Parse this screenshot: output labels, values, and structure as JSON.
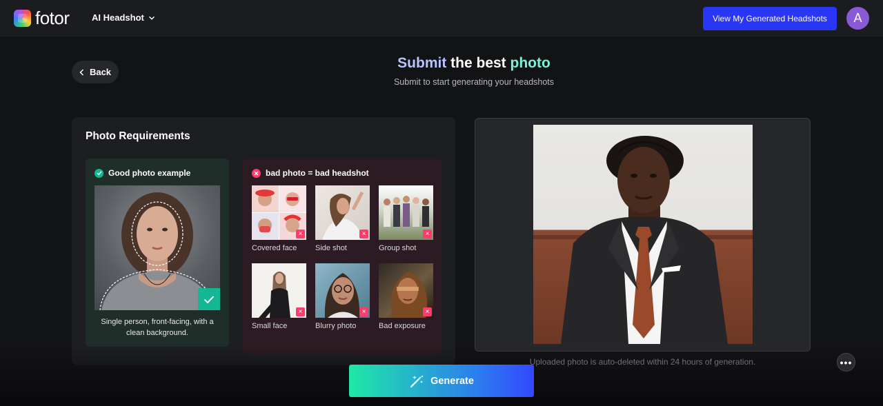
{
  "brand": {
    "name": "fotor"
  },
  "nav": {
    "menu_label": "AI Headshot"
  },
  "header": {
    "view_button_label": "View My Generated Headshots",
    "avatar_letter": "A"
  },
  "page": {
    "back_label": "Back",
    "title_part1": "Submit",
    "title_part2": " the best ",
    "title_part3": "photo",
    "subtitle": "Submit to start generating your headshots"
  },
  "requirements": {
    "title": "Photo Requirements",
    "good": {
      "heading": "Good photo example",
      "caption": "Single person, front-facing, with a clean background."
    },
    "bad": {
      "heading": "bad photo = bad headshot",
      "items": [
        {
          "label": "Covered face"
        },
        {
          "label": "Side shot"
        },
        {
          "label": "Group shot"
        },
        {
          "label": "Small face"
        },
        {
          "label": "Blurry photo"
        },
        {
          "label": "Bad exposure"
        }
      ]
    }
  },
  "upload": {
    "notice": "Uploaded photo is auto-deleted within 24 hours of generation."
  },
  "actions": {
    "generate_label": "Generate",
    "more_label": "•••"
  },
  "colors": {
    "accent_blue": "#2a36f5",
    "success_green": "#14b793",
    "error_pink": "#ff3b6b",
    "generate_gradient_start": "#1fe8a6",
    "generate_gradient_end": "#3447ff"
  }
}
